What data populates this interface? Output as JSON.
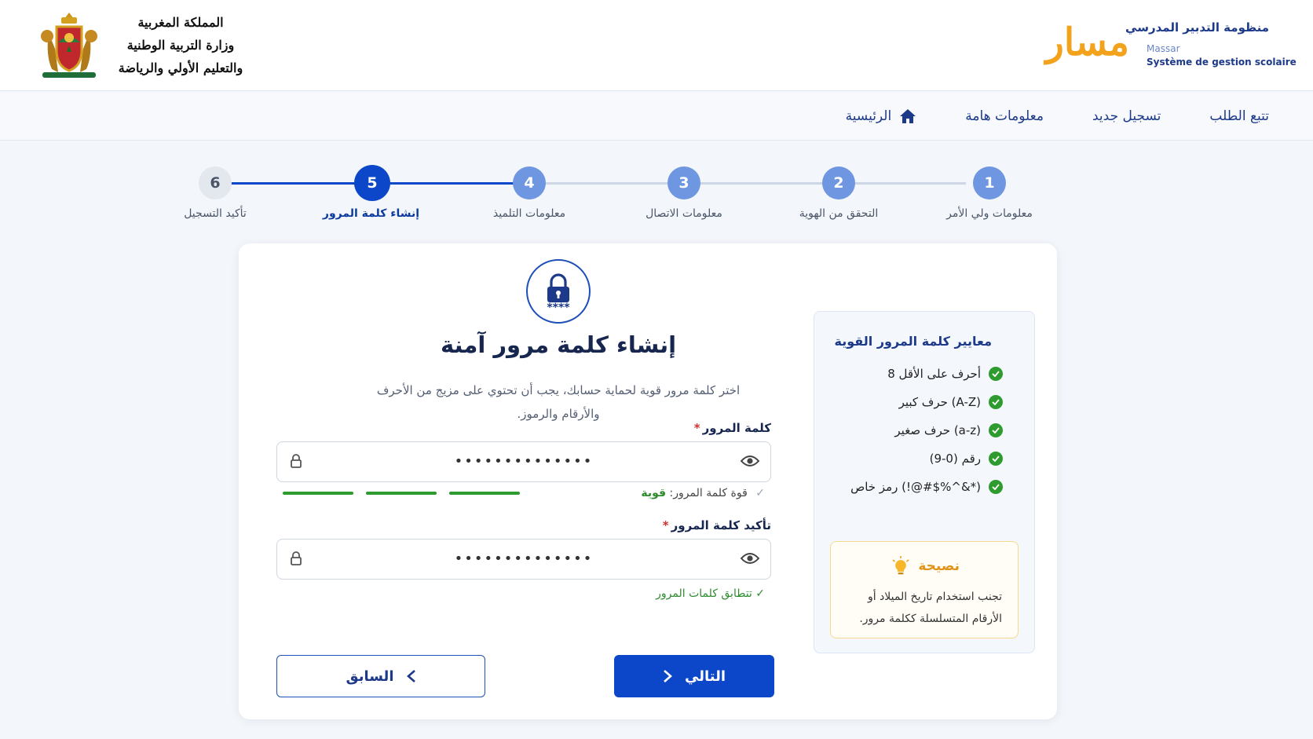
{
  "header": {
    "ministry_lines": [
      "المملكة المغربية",
      "وزارة التربية الوطنية",
      "والتعليم الأولي والرياضة"
    ],
    "brand_logo": "مسار",
    "brand_title": "منظومة التدبير المدرسي",
    "brand_latin": "Massar",
    "brand_subtitle": "Système de gestion scolaire"
  },
  "nav": {
    "items": [
      {
        "label": "الرئيسية",
        "icon": "home-icon"
      },
      {
        "label": "معلومات هامة"
      },
      {
        "label": "تسجيل جديد"
      },
      {
        "label": "تتبع الطلب"
      }
    ]
  },
  "stepper": {
    "steps": [
      {
        "number": "1",
        "label": "معلومات ولي الأمر",
        "state": "done"
      },
      {
        "number": "2",
        "label": "التحقق من الهوية",
        "state": "done"
      },
      {
        "number": "3",
        "label": "معلومات الاتصال",
        "state": "done"
      },
      {
        "number": "4",
        "label": "معلومات التلميذ",
        "state": "done"
      },
      {
        "number": "5",
        "label": "إنشاء كلمة المرور",
        "state": "active"
      },
      {
        "number": "6",
        "label": "تأكيد التسجيل",
        "state": "pending"
      }
    ]
  },
  "form": {
    "badge_stars": "****",
    "title": "إنشاء كلمة مرور آمنة",
    "description": "اختر كلمة مرور قوية لحماية حسابك، يجب أن تحتوي على مزيج من الأحرف والأرقام والرموز.",
    "password": {
      "label": "كلمة المرور",
      "required_mark": "*",
      "value": "••••••••••••••"
    },
    "strength": {
      "prefix": "قوة كلمة المرور:",
      "value": "قوية",
      "check": "✓",
      "level_segments_filled": 3,
      "level_segments_total": 3
    },
    "confirm": {
      "label": "تأكيد كلمة المرور",
      "required_mark": "*",
      "value": "••••••••••••••"
    },
    "match_text": "✓ تتطابق كلمات المرور",
    "next_label": "التالي",
    "prev_label": "السابق"
  },
  "criteria": {
    "title": "معايير كلمة المرور القوية",
    "items": [
      "8 أحرف على الأقل",
      "حرف كبير (A-Z)",
      "حرف صغير (a-z)",
      "رقم (0-9)",
      "رمز خاص (!@#$%^&*)"
    ]
  },
  "tip": {
    "title": "نصيحة",
    "text": "تجنب استخدام تاريخ الميلاد أو الأرقام المتسلسلة ككلمة مرور."
  },
  "colors": {
    "primary": "#0d47c9",
    "step_done": "#6f96e0",
    "success": "#2e9b2e",
    "tip_accent": "#e0941a"
  }
}
